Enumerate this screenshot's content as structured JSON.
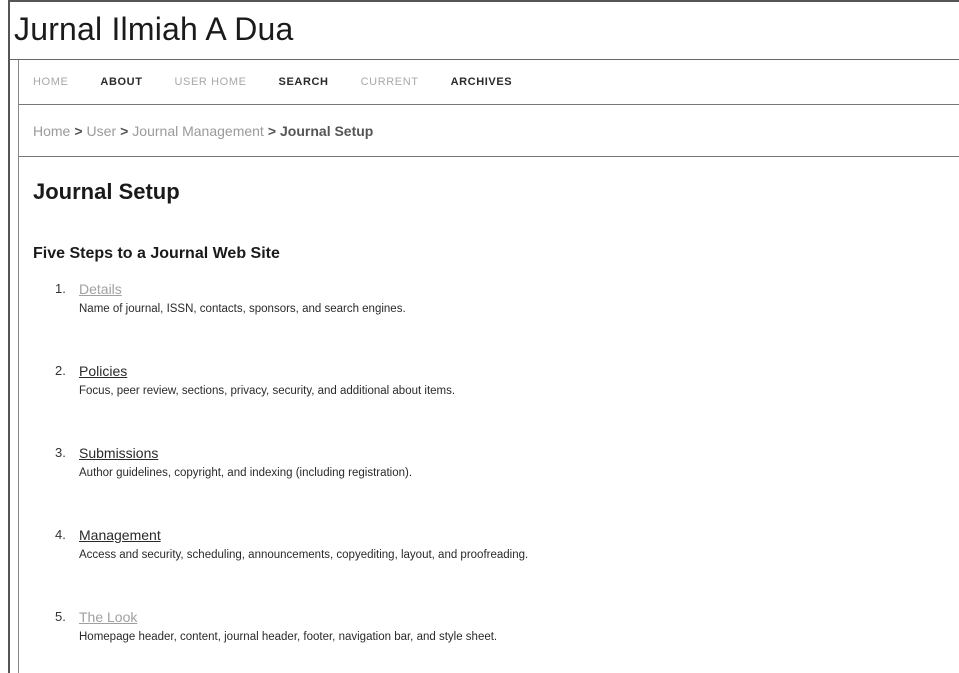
{
  "site": {
    "title": "Jurnal Ilmiah A Dua"
  },
  "nav": {
    "items": [
      {
        "label": "HOME",
        "style": "light"
      },
      {
        "label": "ABOUT",
        "style": "dark"
      },
      {
        "label": "USER HOME",
        "style": "light"
      },
      {
        "label": "SEARCH",
        "style": "dark"
      },
      {
        "label": "CURRENT",
        "style": "light"
      },
      {
        "label": "ARCHIVES",
        "style": "dark"
      }
    ]
  },
  "breadcrumb": {
    "items": [
      "Home",
      "User",
      "Journal Management"
    ],
    "separator": ">",
    "current": "Journal Setup"
  },
  "page": {
    "title": "Journal Setup",
    "section_heading": "Five Steps to a Journal Web Site"
  },
  "steps": [
    {
      "number": "1.",
      "label": "Details",
      "description": "Name of journal, ISSN, contacts, sponsors, and search engines."
    },
    {
      "number": "2.",
      "label": "Policies",
      "description": "Focus, peer review, sections, privacy, security, and additional about items."
    },
    {
      "number": "3.",
      "label": "Submissions",
      "description": "Author guidelines, copyright, and indexing (including registration)."
    },
    {
      "number": "4.",
      "label": "Management",
      "description": "Access and security, scheduling, announcements, copyediting, layout, and proofreading."
    },
    {
      "number": "5.",
      "label": "The Look",
      "description": "Homepage header, content, journal header, footer, navigation bar, and style sheet."
    }
  ],
  "colors": {
    "link_dark": "#2a2a2a",
    "link_light": "#a0a0a0",
    "border": "#777777"
  }
}
